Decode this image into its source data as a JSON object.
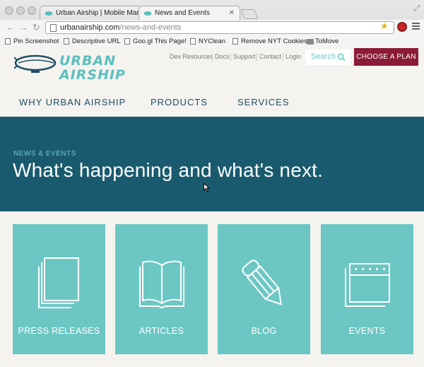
{
  "browser": {
    "tabs": [
      {
        "label": "Urban Airship | Mobile Marke"
      },
      {
        "label": "News and Events"
      }
    ],
    "url": {
      "domain": "urbanairship.com",
      "path": "/news-and-events"
    },
    "bookmarks": [
      {
        "label": "Pin Screenshot"
      },
      {
        "label": "Descriptive URL"
      },
      {
        "label": "Goo.gl This Page!"
      },
      {
        "label": "NYClean"
      },
      {
        "label": "Remove NYT Cookies"
      },
      {
        "label": "ToMove"
      }
    ]
  },
  "site": {
    "logo": {
      "line1": "URBAN",
      "line2": "AIRSHIP"
    },
    "utility_links": [
      "Dev Resources",
      "Docs",
      "Support",
      "Contact",
      "Login"
    ],
    "search_placeholder": "Search",
    "cta_label": "CHOOSE A PLAN",
    "nav": [
      "WHY URBAN AIRSHIP",
      "PRODUCTS",
      "SERVICES"
    ]
  },
  "hero": {
    "eyebrow": "NEWS & EVENTS",
    "headline": "What's happening and what's next."
  },
  "tiles": [
    {
      "label": "PRESS RELEASES",
      "icon": "documents-icon"
    },
    {
      "label": "ARTICLES",
      "icon": "open-book-icon"
    },
    {
      "label": "BLOG",
      "icon": "pencil-icon"
    },
    {
      "label": "EVENTS",
      "icon": "calendar-icon"
    }
  ],
  "colors": {
    "hero_bg": "#1a5a6e",
    "tile_bg": "#6cc7c4",
    "cta_bg": "#8b1c38",
    "nav_text": "#1d4e63"
  }
}
